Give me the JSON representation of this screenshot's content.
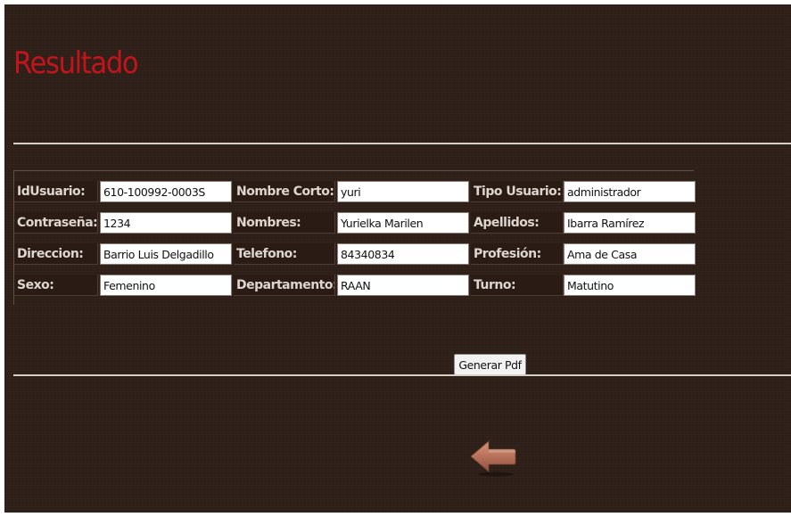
{
  "page": {
    "title": "Resultado"
  },
  "fields": [
    {
      "label": "IdUsuario:",
      "value": "610-100992-0003S"
    },
    {
      "label": "Nombre Corto:",
      "value": "yuri"
    },
    {
      "label": "Tipo Usuario:",
      "value": "administrador"
    },
    {
      "label": "Contraseña:",
      "value": "1234"
    },
    {
      "label": "Nombres:",
      "value": "Yurielka Marilen"
    },
    {
      "label": "Apellidos:",
      "value": "Ibarra Ramírez"
    },
    {
      "label": "Direccion:",
      "value": "Barrio Luis Delgadillo"
    },
    {
      "label": "Telefono:",
      "value": "84340834"
    },
    {
      "label": "Profesión:",
      "value": "Ama de Casa"
    },
    {
      "label": "Sexo:",
      "value": "Femenino"
    },
    {
      "label": "Departamento:",
      "value": "RAAN"
    },
    {
      "label": "Turno:",
      "value": "Matutino"
    }
  ],
  "actions": {
    "generate_pdf_label": "Generar Pdf",
    "back_icon": "left-arrow-icon"
  },
  "colors": {
    "background": "#2e2018",
    "title": "#c4141b",
    "label_text": "#ddd5cf",
    "arrow": "#b8725a",
    "divider": "#d6cfc8"
  }
}
